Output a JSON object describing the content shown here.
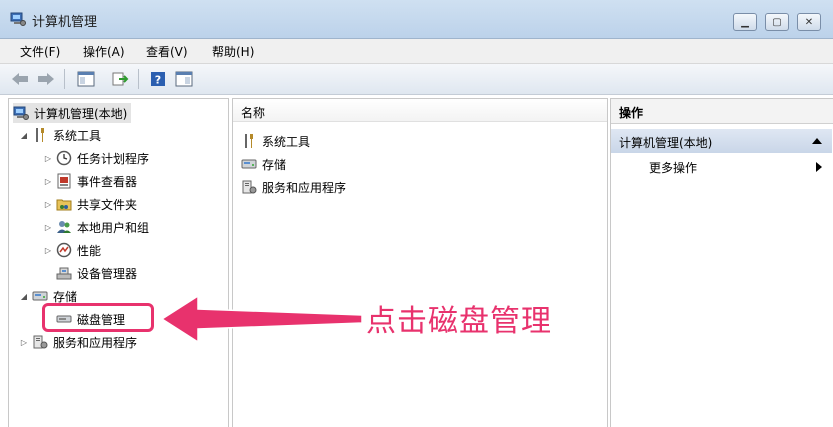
{
  "window": {
    "title": "计算机管理"
  },
  "menu": [
    "文件(F)",
    "操作(A)",
    "查看(V)",
    "帮助(H)"
  ],
  "tree": {
    "root": "计算机管理(本地)",
    "system_tools": "系统工具",
    "task_scheduler": "任务计划程序",
    "event_viewer": "事件查看器",
    "shared_folders": "共享文件夹",
    "local_users": "本地用户和组",
    "performance": "性能",
    "device_manager": "设备管理器",
    "storage": "存储",
    "disk_management": "磁盘管理",
    "services_apps": "服务和应用程序"
  },
  "list": {
    "header": "名称",
    "items": [
      "系统工具",
      "存储",
      "服务和应用程序"
    ]
  },
  "actions": {
    "header": "操作",
    "section": "计算机管理(本地)",
    "more": "更多操作"
  },
  "annotation": {
    "text": "点击磁盘管理",
    "color": "#e8326d"
  }
}
